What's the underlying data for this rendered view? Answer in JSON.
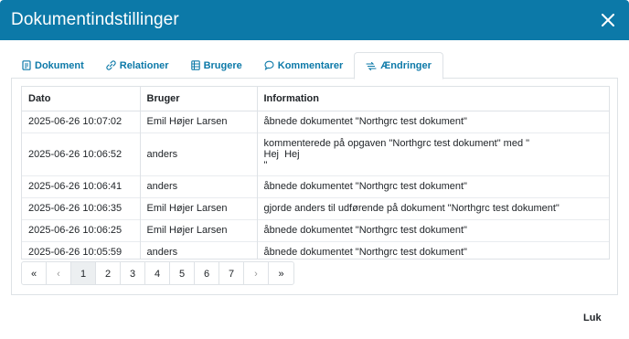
{
  "modal": {
    "title": "Dokumentindstillinger",
    "close_icon": "close-icon"
  },
  "tabs": [
    {
      "label": "Dokument",
      "icon": "document-icon",
      "active": false
    },
    {
      "label": "Relationer",
      "icon": "link-icon",
      "active": false
    },
    {
      "label": "Brugere",
      "icon": "users-list-icon",
      "active": false
    },
    {
      "label": "Kommentarer",
      "icon": "comment-icon",
      "active": false
    },
    {
      "label": "Ændringer",
      "icon": "changes-icon",
      "active": true
    }
  ],
  "table": {
    "headers": [
      "Dato",
      "Bruger",
      "Information"
    ],
    "rows": [
      {
        "date": "2025-06-26 10:07:02",
        "user": "Emil Højer Larsen",
        "info": "åbnede dokumentet \"Northgrc test dokument\""
      },
      {
        "date": "2025-06-26 10:06:52",
        "user": "anders",
        "info_lines": [
          "kommenterede på opgaven \"Northgrc test dokument\" med \"",
          "Hej  Hej",
          "\""
        ]
      },
      {
        "date": "2025-06-26 10:06:41",
        "user": "anders",
        "info": "åbnede dokumentet \"Northgrc test dokument\""
      },
      {
        "date": "2025-06-26 10:06:35",
        "user": "Emil Højer Larsen",
        "info": "gjorde anders til udførende på dokument \"Northgrc test dokument\""
      },
      {
        "date": "2025-06-26 10:06:25",
        "user": "Emil Højer Larsen",
        "info": "åbnede dokumentet \"Northgrc test dokument\""
      },
      {
        "date": "2025-06-26 10:05:59",
        "user": "anders",
        "info": "åbnede dokumentet \"Northgrc test dokument\""
      }
    ]
  },
  "pagination": {
    "first": "«",
    "prev": "‹",
    "pages": [
      "1",
      "2",
      "3",
      "4",
      "5",
      "6",
      "7"
    ],
    "current": "1",
    "next": "›",
    "last": "»"
  },
  "footer": {
    "close_label": "Luk"
  },
  "colors": {
    "header_bg": "#0c79a8",
    "accent": "#0c79a8",
    "active_page_bg": "#eceff1"
  }
}
